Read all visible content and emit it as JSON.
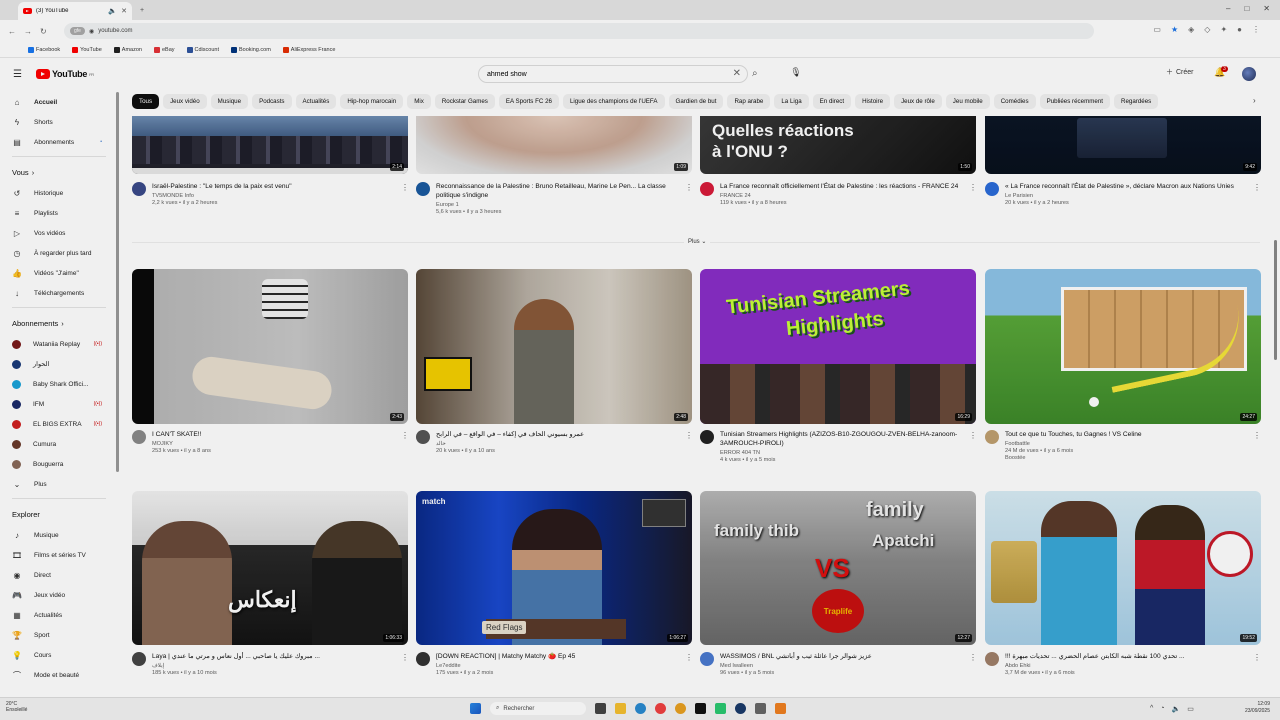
{
  "browser": {
    "tab_title": "(3) YouTube",
    "url": "youtube.com",
    "url_chip": "gfe",
    "bookmarks": [
      "Facebook",
      "YouTube",
      "Amazon",
      "eBay",
      "Cdiscount",
      "Booking.com",
      "AliExpress France"
    ]
  },
  "header": {
    "logo": "YouTube",
    "logo_sup": "FR",
    "search_value": "ahmed show",
    "create_label": "Créer",
    "notif_count": "3"
  },
  "sidebar": {
    "main": [
      {
        "label": "Accueil",
        "icon": "home-icon"
      },
      {
        "label": "Shorts",
        "icon": "shorts-icon"
      },
      {
        "label": "Abonnements",
        "icon": "subscriptions-icon"
      }
    ],
    "you_title": "Vous",
    "you": [
      {
        "label": "Historique",
        "icon": "history-icon"
      },
      {
        "label": "Playlists",
        "icon": "playlist-icon"
      },
      {
        "label": "Vos vidéos",
        "icon": "video-icon"
      },
      {
        "label": "À regarder plus tard",
        "icon": "clock-icon"
      },
      {
        "label": "Vidéos \"J'aime\"",
        "icon": "like-icon"
      },
      {
        "label": "Téléchargements",
        "icon": "download-icon"
      }
    ],
    "subs_title": "Abonnements",
    "subs": [
      {
        "label": "Wataniia Replay",
        "color": "#7a1a1a"
      },
      {
        "label": "الحوار",
        "color": "#1a3b7a"
      },
      {
        "label": "Baby Shark Offici...",
        "color": "#1aa3d9"
      },
      {
        "label": "IFM",
        "color": "#1b2b6b"
      },
      {
        "label": "EL BIGS EXTRA",
        "color": "#d02020"
      },
      {
        "label": "Cumura",
        "color": "#6b3b2b"
      },
      {
        "label": "Bouguerra",
        "color": "#8a6a5a"
      }
    ],
    "more_label": "Plus",
    "explore_title": "Explorer",
    "explore": [
      {
        "label": "Musique",
        "icon": "music-icon"
      },
      {
        "label": "Films et séries TV",
        "icon": "film-icon"
      },
      {
        "label": "Direct",
        "icon": "live-icon"
      },
      {
        "label": "Jeux vidéo",
        "icon": "gamepad-icon"
      },
      {
        "label": "Actualités",
        "icon": "news-icon"
      },
      {
        "label": "Sport",
        "icon": "trophy-icon"
      },
      {
        "label": "Cours",
        "icon": "bulb-icon"
      },
      {
        "label": "Mode et beauté",
        "icon": "hanger-icon"
      }
    ]
  },
  "chips": [
    "Tous",
    "Jeux vidéo",
    "Musique",
    "Podcasts",
    "Actualités",
    "Hip-hop marocain",
    "Mix",
    "Rockstar Games",
    "EA Sports FC 26",
    "Ligue des champions de l'UEFA",
    "Gardien de but",
    "Rap arabe",
    "La Liga",
    "En direct",
    "Histoire",
    "Jeux de rôle",
    "Jeu mobile",
    "Comédies",
    "Publiées récemment",
    "Regardées"
  ],
  "more_button": "Plus",
  "row1": [
    {
      "title": "Israël-Palestine : \"Le temps de la paix est venu\"",
      "channel": "TV5MONDE Info",
      "stats": "2,2 k vues • il y a 2 heures",
      "duration": "2:14",
      "av": "#3a4a8a"
    },
    {
      "title": "Reconnaissance de la Palestine : Bruno Retailleau, Marine Le Pen... La classe politique s'indigne",
      "channel": "Europe 1",
      "stats": "5,6 k vues • il y a 3 heures",
      "duration": "1:09",
      "av": "#1a5aa0"
    },
    {
      "title": "La France reconnaît officiellement l'État de Palestine : les réactions - FRANCE 24",
      "channel": "FRANCE 24",
      "stats": "119 k vues • il y a 8 heures",
      "duration": "1:50",
      "av": "#d81b3a"
    },
    {
      "title": "« La France reconnaît l'État de Palestine », déclare Macron aux Nations Unies",
      "channel": "Le Parisien",
      "stats": "20 k vues • il y a 2 heures",
      "duration": "9:42",
      "av": "#2b6cd9"
    }
  ],
  "row2": [
    {
      "title": "I CAN'T SKATE!!",
      "channel": "MOJIKY",
      "stats": "253 k vues • il y a 8 ans",
      "duration": "2:43",
      "av": "#8a8a8a"
    },
    {
      "title": "عمرو بسيوني الحاف في إكفاء – في الواقع – في الرابح",
      "channel": "خالد",
      "stats": "20 k vues • il y a 10 ans",
      "duration": "2:48",
      "av": "#555"
    },
    {
      "title": "Tunisian Streamers Highlights (AZIZOS-B10-ZGOUGOU-ZVEN-BELHA-zanoom-3AMROUCH-PIROLI)",
      "channel": "ERROR 404 TN",
      "stats": "4 k vues • il y a 5 mois",
      "duration": "16:29",
      "av": "#222"
    },
    {
      "title": "Tout ce que tu Touches, tu Gagnes ! VS Celine",
      "channel": "Footbattle",
      "stats": "24 M de vues • il y a 6 mois",
      "extra": "Boostée",
      "duration": "24:27",
      "av": "#c0a070"
    }
  ],
  "row3": [
    {
      "title": "Laya | مبروك عليك يا صاحبي ... أول نعاس و مرتي ما عندي ...",
      "channel": "إيلاف",
      "stats": "185 k vues • il y a 10 mois",
      "duration": "1:06:33",
      "av": "#444"
    },
    {
      "title": "[DOWN REACTION] | Matchy Matchy 🍅 Ep 45",
      "channel": "Le7eddite",
      "stats": "175 vues • il y a 2 mois",
      "duration": "1:06:27",
      "av": "#333"
    },
    {
      "title": "WASSIMOS / BNL عزيز شوالر جرا عائلة ثيب و أباتشي",
      "channel": "Med Iwalleen",
      "stats": "96 vues • il y a 5 mois",
      "duration": "12:27",
      "av": "#4a7ad0"
    },
    {
      "title": "!!! تحدي 100 نقطة شبه الكابتن عصام الحضري ... تحديات مبهرة ...",
      "channel": "Abdo Ehki",
      "stats": "3,7 M de vues • il y a 6 mois",
      "duration": "19:52",
      "av": "#a0806a"
    }
  ],
  "thumb_text": {
    "r1c3_a": "Quelles réactions",
    "r1c3_b": "à l'ONU ?",
    "r2c3_a": "Tunisian Streamers",
    "r2c3_b": "Highlights",
    "r3c1": "إنعكاس",
    "r3c2_match": "match",
    "r3c2_flag": "Red Flags",
    "r3c3_a": "family thib",
    "r3c3_b": "family",
    "r3c3_c": "Apatchi",
    "r3c3_vs": "VS",
    "r3c3_logo": "Traplife"
  },
  "taskbar": {
    "weather_temp": "20°C",
    "weather_desc": "Ensoleillé",
    "search_label": "Rechercher",
    "time": "12:09",
    "date": "23/09/2025"
  }
}
